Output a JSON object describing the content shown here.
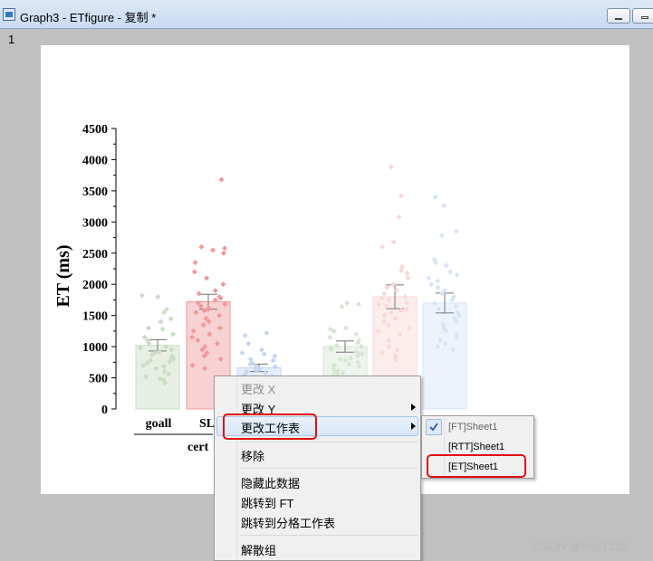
{
  "window": {
    "title": "Graph3 - ETfigure - 复制 *",
    "controls": [
      "minimize",
      "restore"
    ]
  },
  "graph": {
    "layer_number": "1"
  },
  "context_menu": {
    "items": [
      {
        "label": "更改 X",
        "enabled": false
      },
      {
        "label": "更改 Y",
        "enabled": true,
        "has_submenu": true
      },
      {
        "label": "更改工作表",
        "enabled": true,
        "has_submenu": true,
        "highlighted": true
      },
      {
        "label": "移除",
        "enabled": true
      },
      {
        "label": "隐藏此数据",
        "enabled": true
      },
      {
        "label": "跳转到 FT",
        "enabled": true
      },
      {
        "label": "跳转到分格工作表",
        "enabled": true
      },
      {
        "label": "解散组",
        "enabled": true
      }
    ]
  },
  "submenu": {
    "items": [
      {
        "label": "[FT]Sheet1",
        "checked": true,
        "enabled": false
      },
      {
        "label": "[RTT]Sheet1",
        "checked": false,
        "enabled": true
      },
      {
        "label": "[ET]Sheet1",
        "checked": false,
        "enabled": true,
        "annotated": true
      }
    ]
  },
  "chart_data": {
    "type": "bar",
    "ylabel": "ET (ms)",
    "ylim": [
      0,
      4500
    ],
    "yticks": [
      0,
      500,
      1000,
      1500,
      2000,
      2500,
      3000,
      3500,
      4000,
      4500
    ],
    "x_tick_labels": [
      "goall",
      "SL"
    ],
    "x_group_label": "cert",
    "bars": [
      {
        "group": 1,
        "value": 1020,
        "error": 90,
        "color": "#c9dcc5",
        "points": [
          1820,
          1800,
          1600,
          1550,
          1450,
          1400,
          1300,
          1280,
          1200,
          1150,
          1100,
          1050,
          1000,
          980,
          950,
          920,
          900,
          870,
          850,
          820,
          800,
          780,
          760,
          740,
          700,
          680,
          650,
          600,
          560,
          520,
          480,
          460,
          420
        ]
      },
      {
        "group": 1,
        "value": 1720,
        "error": 120,
        "color": "#f0999b",
        "points": [
          3680,
          2600,
          2580,
          2550,
          2500,
          2350,
          2200,
          2100,
          2000,
          1900,
          1850,
          1800,
          1780,
          1750,
          1700,
          1680,
          1650,
          1620,
          1600,
          1580,
          1550,
          1500,
          1450,
          1400,
          1350,
          1300,
          1250,
          1200,
          1150,
          1100,
          1050,
          1000,
          950,
          900,
          850,
          800,
          700,
          650
        ]
      },
      {
        "group": 1,
        "value": 660,
        "error": 60,
        "color": "#c4d6f2",
        "points": [
          1220,
          1180,
          1050,
          950,
          900,
          880,
          850,
          800,
          780,
          750,
          720,
          700,
          680,
          660,
          640,
          620,
          600,
          580,
          550,
          520,
          500,
          480,
          450,
          420,
          400
        ]
      },
      {
        "group": 2,
        "value": 1000,
        "error": 90,
        "color": "#d6e6d2",
        "points": [
          1700,
          1680,
          1640,
          1300,
          1280,
          1250,
          1200,
          1150,
          1100,
          1060,
          1020,
          1000,
          980,
          950,
          920,
          900,
          880,
          850,
          820,
          800,
          780,
          750,
          720,
          700,
          680,
          650,
          620,
          600,
          580,
          560,
          520,
          500,
          470
        ]
      },
      {
        "group": 2,
        "value": 1800,
        "error": 190,
        "color": "#f9d6d7",
        "points": [
          3880,
          3420,
          3080,
          2680,
          2600,
          2280,
          2220,
          2180,
          2100,
          2000,
          1950,
          1900,
          1850,
          1800,
          1780,
          1750,
          1700,
          1680,
          1650,
          1600,
          1580,
          1550,
          1500,
          1450,
          1400,
          1350,
          1300,
          1250,
          1200,
          1100,
          1000,
          950,
          900,
          850,
          800
        ]
      },
      {
        "group": 2,
        "value": 1700,
        "error": 160,
        "color": "#d7e4f6",
        "points": [
          3400,
          3260,
          2850,
          2780,
          2400,
          2350,
          2300,
          2200,
          2150,
          2100,
          2050,
          2000,
          1950,
          1900,
          1850,
          1800,
          1750,
          1700,
          1650,
          1600,
          1550,
          1500,
          1450,
          1400,
          1350,
          1300,
          1250,
          1200,
          1150,
          1100,
          1050,
          1000,
          950
        ]
      }
    ]
  },
  "watermark": "CSDN @linly1219"
}
